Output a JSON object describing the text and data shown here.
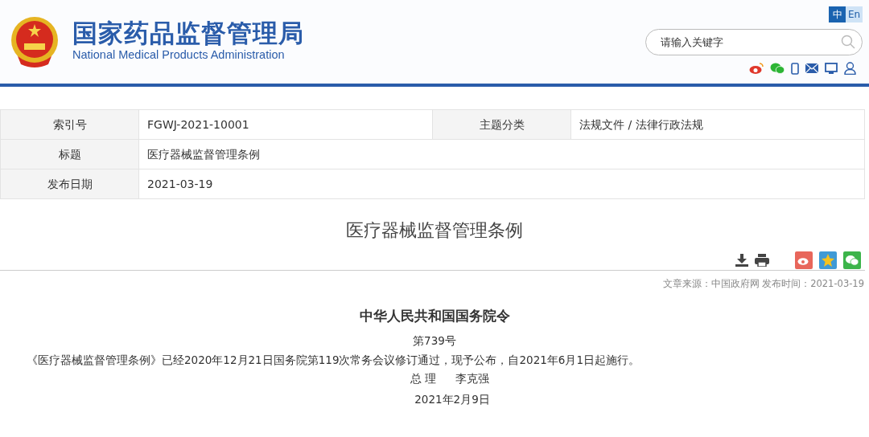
{
  "header": {
    "title": "国家药品监督管理局",
    "subtitle": "National Medical Products Administration"
  },
  "languages": [
    {
      "label": "中",
      "selected": true
    },
    {
      "label": "En",
      "selected": false
    }
  ],
  "search": {
    "placeholder": "请输入关键字"
  },
  "meta": [
    [
      {
        "label": "索引号",
        "value": "FGWJ-2021-10001"
      },
      {
        "label": "主题分类",
        "value": "法规文件 / 法律行政法规"
      }
    ],
    [
      {
        "label": "标题",
        "value": "医疗器械监督管理条例"
      }
    ],
    [
      {
        "label": "发布日期",
        "value": "2021-03-19"
      }
    ]
  ],
  "article": {
    "title": "医疗器械监督管理条例",
    "source": "文章来源：中国政府网 发布时间：2021-03-19",
    "heading": "中华人民共和国国务院令",
    "number": "第739号",
    "paragraph": "《医疗器械监督管理条例》已经2020年12月21日国务院第119次常务会议修订通过，现予公布，自2021年6月1日起施行。",
    "signature_role": "总 理",
    "signature_name": "李克强",
    "date": "2021年2月9日"
  }
}
